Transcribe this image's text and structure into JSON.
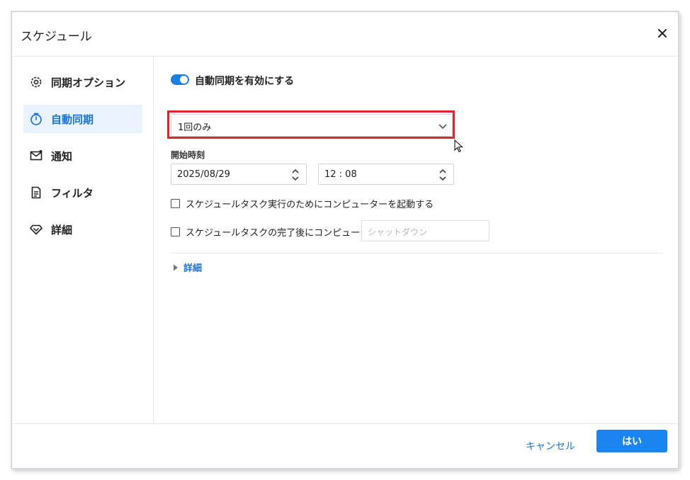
{
  "dialog": {
    "title": "スケジュール"
  },
  "sidebar": {
    "items": [
      {
        "label": "同期オプション",
        "icon": "gear-icon"
      },
      {
        "label": "自動同期",
        "icon": "timer-icon",
        "active": true
      },
      {
        "label": "通知",
        "icon": "mail-icon"
      },
      {
        "label": "フィルタ",
        "icon": "document-icon"
      },
      {
        "label": "詳細",
        "icon": "diamond-icon"
      }
    ]
  },
  "main": {
    "toggle_label": "自動同期を有効にする",
    "frequency_value": "1回のみ",
    "start_time_label": "開始時刻",
    "date_value": "2025/08/29",
    "time_value": "12 : 08",
    "wake_checkbox_label": "スケジュールタスク実行のためにコンピューターを起動する",
    "after_checkbox_label": "スケジュールタスクの完了後にコンピューターを",
    "after_action_placeholder": "シャットダウン",
    "details_label": "詳細"
  },
  "footer": {
    "cancel_label": "キャンセル",
    "ok_label": "はい"
  },
  "colors": {
    "accent": "#1a84f0",
    "highlight": "#e0262b",
    "active_bg": "#e8f3fd"
  }
}
